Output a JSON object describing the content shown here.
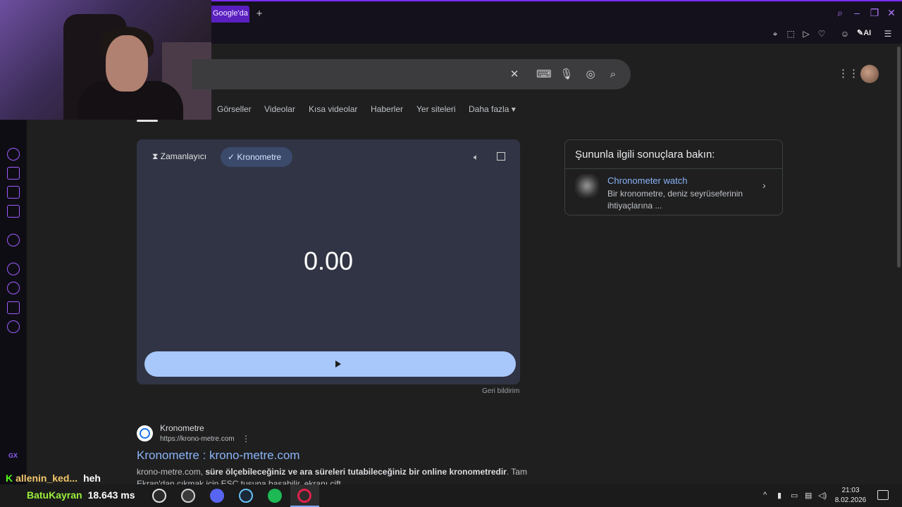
{
  "browser": {
    "tab_title": "Google'da Ar",
    "new_tab": "+",
    "ai_label": "AI"
  },
  "search": {
    "clear_icon": "close-icon",
    "keyboard_icon": "keyboard-icon",
    "mic_icon": "mic-icon",
    "lens_icon": "lens-icon",
    "search_icon": "search-icon"
  },
  "tabs": [
    "Görseller",
    "Videolar",
    "Kısa videolar",
    "Haberler",
    "Yer siteleri",
    "Daha fazla"
  ],
  "stopwatch": {
    "timer_tab": "Zamanlayıcı",
    "stopwatch_tab": "Kronometre",
    "time": "0.00",
    "feedback": "Geri bildirim"
  },
  "related": {
    "title": "Şununla ilgili sonuçlara bakın:",
    "link": "Chronometer watch",
    "desc": "Bir kronometre, deniz seyrüseferinin ihtiyaçlarına ..."
  },
  "result": {
    "site": "Kronometre",
    "url": "https://krono-metre.com",
    "title": "Kronometre : krono-metre.com",
    "snippet_plain_1": "krono-metre.com, ",
    "snippet_bold": "süre ölçebileceğiniz ve ara süreleri tutabileceğiniz bir online kronometredir",
    "snippet_plain_2": ". Tam Ekran'dan çıkmak için ESC tuşuna basabilir, ekranı çift"
  },
  "chat": {
    "line1_user": "allenin_ked...",
    "line1_msg": "heh",
    "line2_user": "BatuKayran",
    "line2_msg": "18.643 ms"
  },
  "taskbar": {
    "time": "21:03",
    "date": "8.02.2026"
  },
  "colors": {
    "accent_opera": "#7b2cff",
    "google_link": "#8ab4f8",
    "start_button": "#a8c7fa",
    "kick_green": "#53fc18"
  }
}
